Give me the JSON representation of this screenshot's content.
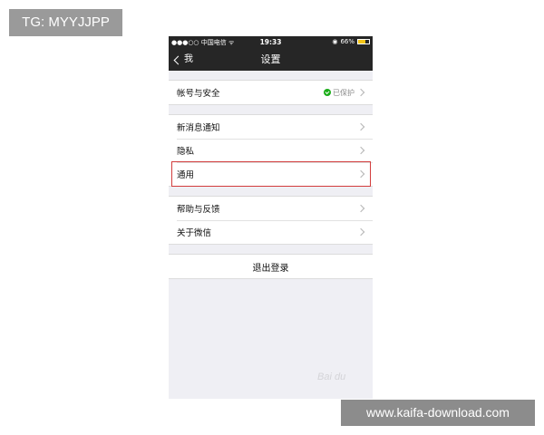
{
  "watermarks": {
    "tg_label": "TG: MYYJJPP",
    "url_label": "www.kaifa-download.com",
    "baidu_label": "Bai du"
  },
  "status_bar": {
    "signal": "●●●○○",
    "carrier": "中国电信",
    "time": "19:33",
    "battery_percent": "66%",
    "battery_level": 0.66
  },
  "nav": {
    "back_label": "我",
    "title": "设置"
  },
  "groups": [
    {
      "items": [
        {
          "label": "帐号与安全",
          "status": "已保护"
        }
      ]
    },
    {
      "items": [
        {
          "label": "新消息通知"
        },
        {
          "label": "隐私"
        },
        {
          "label": "通用"
        }
      ]
    },
    {
      "items": [
        {
          "label": "帮助与反馈"
        },
        {
          "label": "关于微信"
        }
      ]
    }
  ],
  "logout_label": "退出登录",
  "colors": {
    "nav_background": "#262626",
    "highlight_border": "#d23c3c",
    "protected_green": "#1aad19",
    "page_background": "#efeff4"
  }
}
